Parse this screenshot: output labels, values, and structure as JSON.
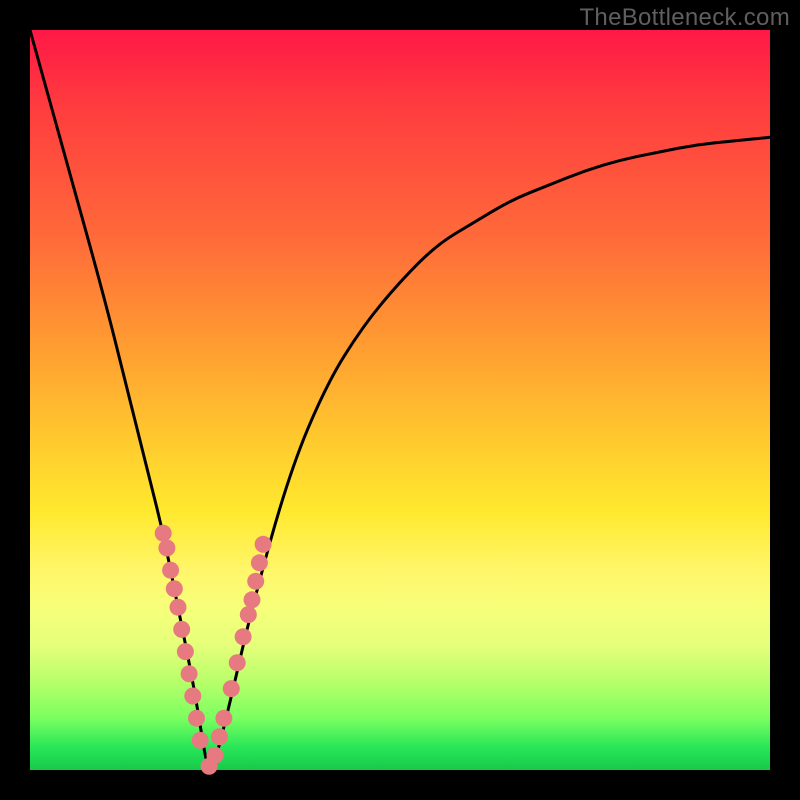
{
  "watermark": "TheBottleneck.com",
  "chart_data": {
    "type": "line",
    "title": "",
    "xlabel": "",
    "ylabel": "",
    "xlim": [
      0,
      100
    ],
    "ylim": [
      0,
      100
    ],
    "series": [
      {
        "name": "bottleneck-curve",
        "x": [
          0,
          5,
          10,
          13,
          16,
          18,
          20,
          22,
          23,
          24,
          25,
          27,
          30,
          35,
          40,
          45,
          50,
          55,
          60,
          65,
          70,
          75,
          80,
          85,
          90,
          95,
          100
        ],
        "values": [
          100,
          82,
          64,
          52,
          40,
          32,
          22,
          12,
          6,
          0,
          1,
          9,
          22,
          40,
          52,
          60,
          66,
          71,
          74,
          77,
          79,
          81,
          82.5,
          83.5,
          84.5,
          85,
          85.5
        ]
      }
    ],
    "markers": {
      "name": "highlight-dots",
      "x": [
        18,
        18.5,
        19,
        19.5,
        20,
        20.5,
        21,
        21.5,
        22,
        22.5,
        23,
        24.2,
        25,
        25.6,
        26.2,
        27.2,
        28,
        28.8,
        29.5,
        30,
        30.5,
        31,
        31.5
      ],
      "values": [
        32,
        30,
        27,
        24.5,
        22,
        19,
        16,
        13,
        10,
        7,
        4,
        0.5,
        2,
        4.5,
        7,
        11,
        14.5,
        18,
        21,
        23,
        25.5,
        28,
        30.5
      ]
    },
    "gradient_stops": [
      {
        "pos": 0,
        "color": "#ff1846"
      },
      {
        "pos": 28,
        "color": "#ff6a3a"
      },
      {
        "pos": 55,
        "color": "#ffc82e"
      },
      {
        "pos": 78,
        "color": "#f7ff7a"
      },
      {
        "pos": 97,
        "color": "#27e658"
      },
      {
        "pos": 100,
        "color": "#18c94a"
      }
    ],
    "marker_color": "#e77a80"
  }
}
